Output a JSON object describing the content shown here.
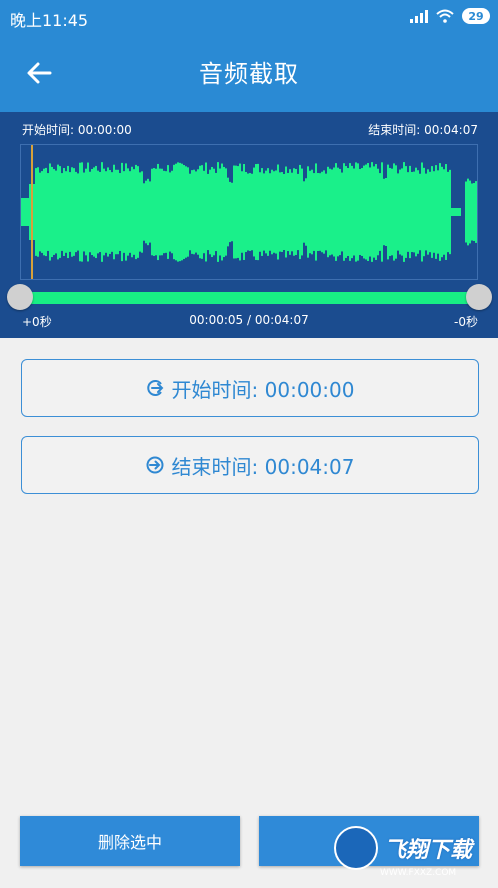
{
  "statusbar": {
    "time": "晚上11:45",
    "battery": "29"
  },
  "appbar": {
    "title": "音频截取",
    "back_icon": "arrow-left-icon"
  },
  "waveform": {
    "start_label": "开始时间: 00:00:00",
    "end_label": "结束时间: 00:04:07",
    "wave_color": "#1af08a",
    "panel_color": "#1b4c8f",
    "left_offset": "+0秒",
    "position": "00:00:05 / 00:04:07",
    "right_offset": "-0秒",
    "playback_fraction": 0.02
  },
  "buttons": {
    "start": {
      "label": "开始时间: 00:00:00",
      "icon": "login-arrow-icon"
    },
    "end": {
      "label": "结束时间: 00:04:07",
      "icon": "arrow-circle-icon"
    },
    "delete": "删除选中"
  },
  "watermark": {
    "text": "飞翔下载",
    "url": "WWW.FXXZ.COM"
  },
  "colors": {
    "accent": "#2a8ad4",
    "button_blue": "#2f8ad8"
  }
}
